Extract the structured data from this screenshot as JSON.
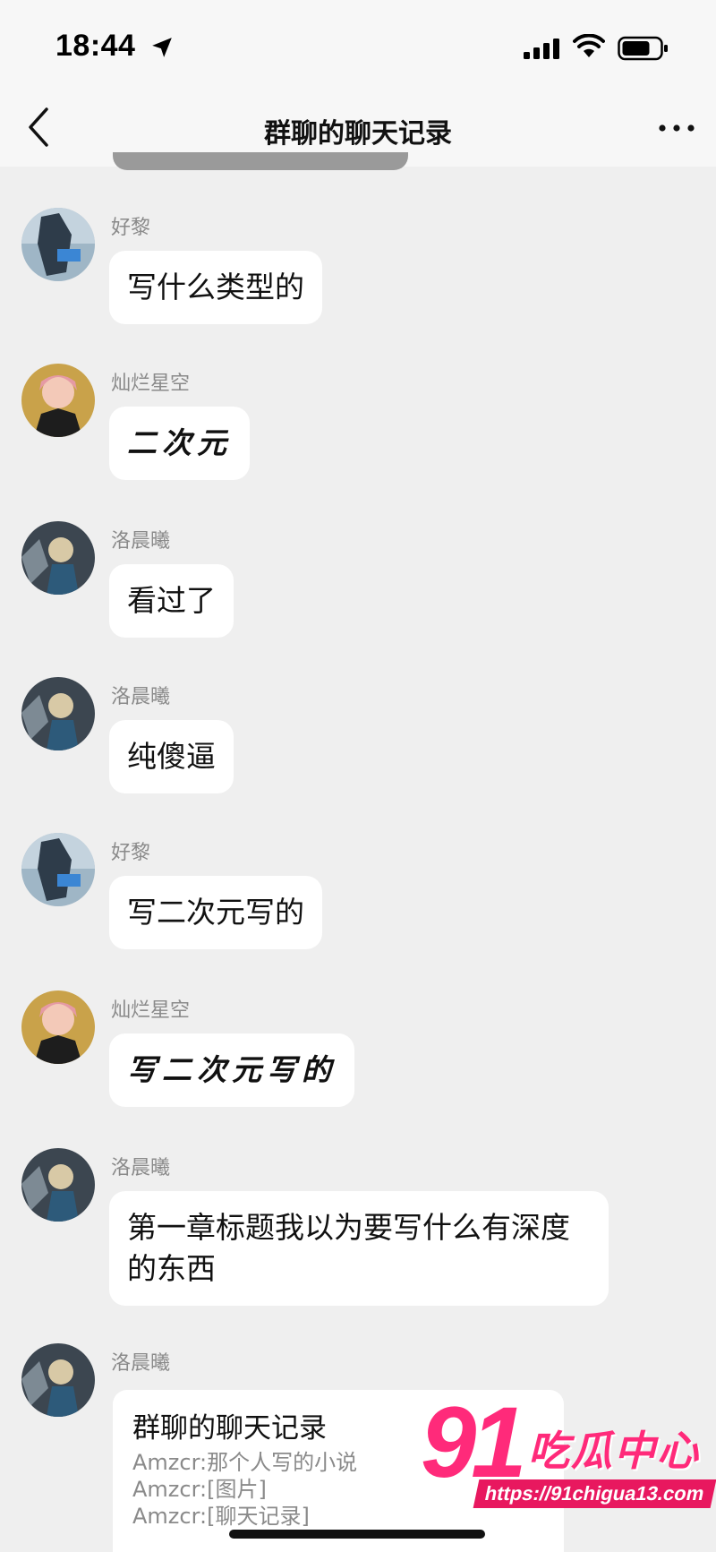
{
  "status_bar": {
    "time": "18:44"
  },
  "nav": {
    "title": "群聊的聊天记录"
  },
  "messages": [
    {
      "sender": "好黎",
      "text": "写什么类型的"
    },
    {
      "sender": "灿烂星空",
      "text": "二次元"
    },
    {
      "sender": "洛晨曦",
      "text": "看过了"
    },
    {
      "sender": "洛晨曦",
      "text": "纯傻逼"
    },
    {
      "sender": "好黎",
      "text": "写二次元写的"
    },
    {
      "sender": "灿烂星空",
      "text": "写二次元写的"
    },
    {
      "sender": "洛晨曦",
      "line1": "第一章标题我以为要写什么有深度",
      "line2": "的东西"
    },
    {
      "sender": "洛晨曦"
    }
  ],
  "card": {
    "title": "群聊的聊天记录",
    "lines": [
      "Amzcr:那个人写的小说",
      "Amzcr:[图片]",
      "Amzcr:[聊天记录]"
    ]
  },
  "watermark": {
    "number": "91",
    "name": "吃瓜中心",
    "url": "https://91chigua13.com"
  },
  "colors": {
    "background": "#efefef",
    "bubble": "#ffffff",
    "watermark": "#ff2a7a"
  },
  "icons": [
    "location-arrow-icon",
    "signal-icon",
    "wifi-icon",
    "battery-icon",
    "back-chevron-icon",
    "more-dots-icon"
  ]
}
